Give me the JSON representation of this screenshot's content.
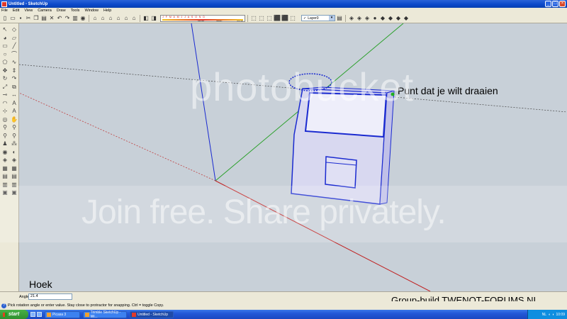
{
  "window": {
    "title": "Untitled - SketchUp"
  },
  "menu": [
    "File",
    "Edit",
    "View",
    "Camera",
    "Draw",
    "Tools",
    "Window",
    "Help"
  ],
  "shadow_settings": {
    "months": "J F M A M J J A S O N D",
    "time_start": "06:43",
    "noon_label": "Noon",
    "time_end": "04:46"
  },
  "layer": {
    "current": "Layer0"
  },
  "viewport": {
    "annotation_point": "Punt dat je wilt draaien",
    "annotation_angle": "Hoek",
    "watermark_brand": "photobucket",
    "watermark_tagline": "Join free. Share privately."
  },
  "measurements": {
    "label": "Angle",
    "value": "21.4"
  },
  "status": {
    "hint": "Pick rotation angle or enter value.  Stay close to protractor for snapping. Ctrl = toggle Copy."
  },
  "credit": "Group-build TWENOT-FORUMS.NL",
  "taskbar": {
    "start": "start",
    "tasks": [
      {
        "label": "Picasa 3",
        "active": false
      },
      {
        "label": "Trimble SketchUp - Wi...",
        "active": false
      },
      {
        "label": "Untitled - SketchUp",
        "active": true
      }
    ],
    "lang": "NL",
    "clock": "10:09"
  }
}
